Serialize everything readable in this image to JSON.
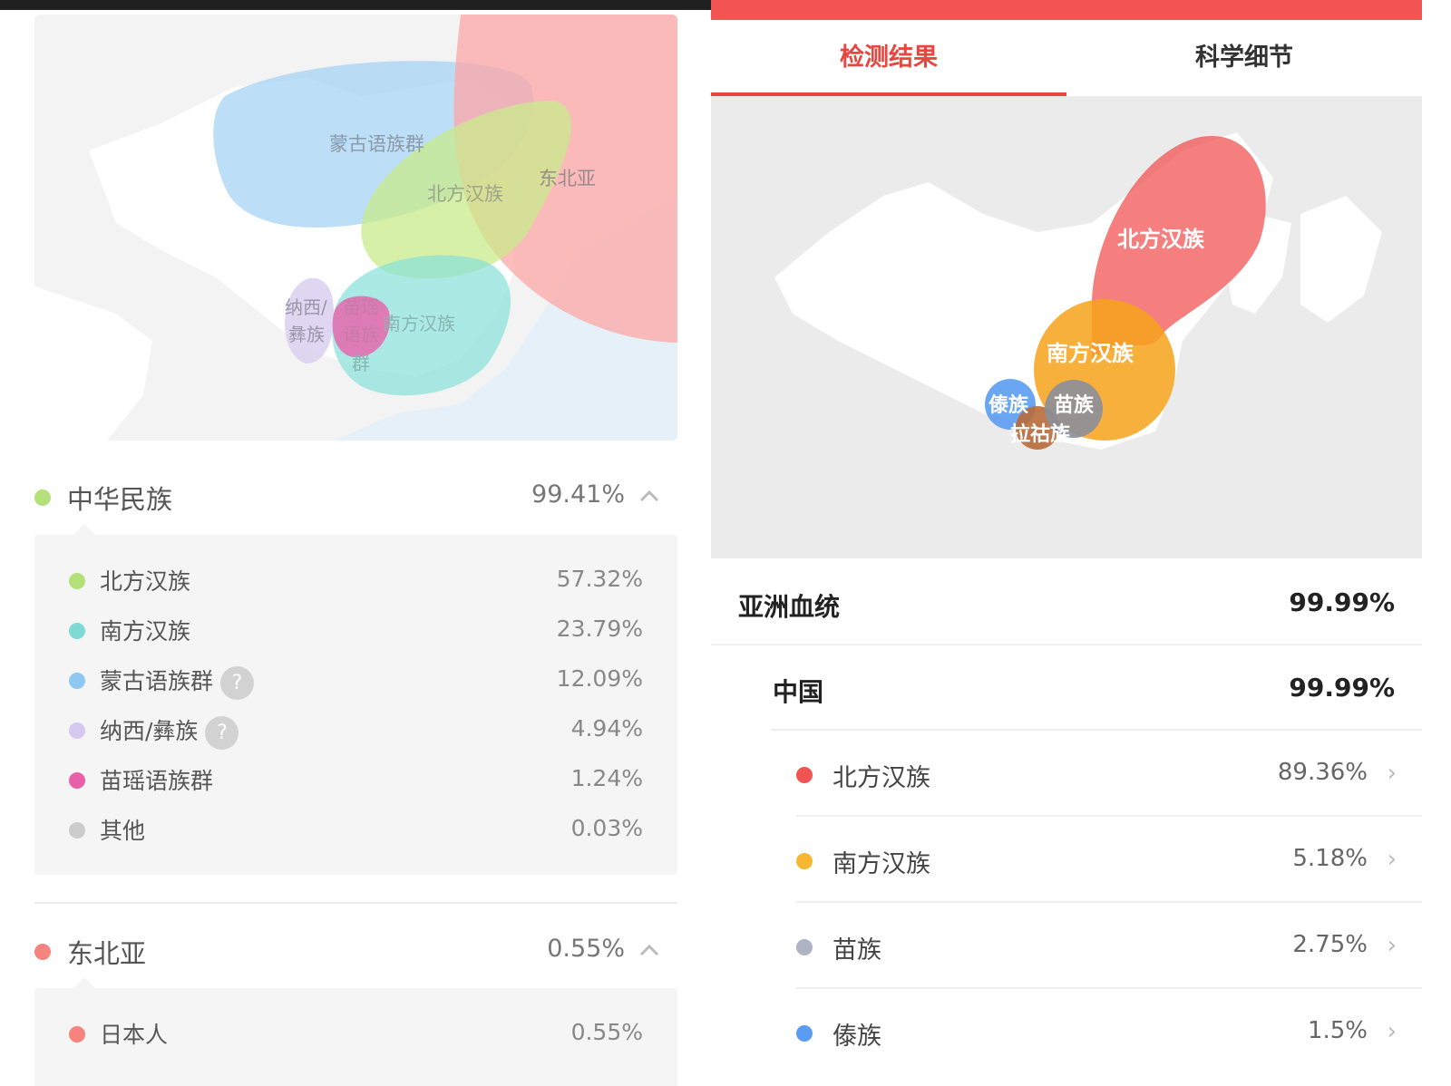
{
  "left": {
    "map_labels": {
      "mongolic": "蒙古语族群",
      "northeast_asia": "东北亚",
      "northern_han": "北方汉族",
      "naxi_line1": "纳西/",
      "naxi_line2": "彝族",
      "miaoyao_line1": "苗瑶",
      "miaoyao_line2": "语族",
      "miaoyao_line3": "群",
      "southern_han": "南方汉族"
    },
    "groups": [
      {
        "name": "中华民族",
        "percent": "99.41%",
        "color": "#b4e07a",
        "items": [
          {
            "name": "北方汉族",
            "percent": "57.32%",
            "color": "#b4e07a"
          },
          {
            "name": "南方汉族",
            "percent": "23.79%",
            "color": "#7fd9d4"
          },
          {
            "name": "蒙古语族群",
            "percent": "12.09%",
            "color": "#8ec8f2",
            "help": "?"
          },
          {
            "name": "纳西/彝族",
            "percent": "4.94%",
            "color": "#d6c8ee",
            "help": "?"
          },
          {
            "name": "苗瑶语族群",
            "percent": "1.24%",
            "color": "#e95fa9"
          },
          {
            "name": "其他",
            "percent": "0.03%",
            "color": "#cccccc"
          }
        ]
      },
      {
        "name": "东北亚",
        "percent": "0.55%",
        "color": "#f7837f",
        "items": [
          {
            "name": "日本人",
            "percent": "0.55%",
            "color": "#f7837f"
          }
        ]
      }
    ]
  },
  "right": {
    "tabs": [
      {
        "label": "检测结果",
        "active": true
      },
      {
        "label": "科学细节",
        "active": false
      }
    ],
    "map_labels": {
      "northern_han": "北方汉族",
      "southern_han": "南方汉族",
      "dai": "傣族",
      "miao": "苗族",
      "lahu": "拉祜族"
    },
    "summary": [
      {
        "name": "亚洲血统",
        "percent": "99.99%"
      },
      {
        "name": "中国",
        "percent": "99.99%"
      }
    ],
    "items": [
      {
        "name": "北方汉族",
        "percent": "89.36%",
        "color": "#f25454",
        "arrow": "›"
      },
      {
        "name": "南方汉族",
        "percent": "5.18%",
        "color": "#f7b733",
        "arrow": "›"
      },
      {
        "name": "苗族",
        "percent": "2.75%",
        "color": "#aeb4c4",
        "arrow": "›"
      },
      {
        "name": "傣族",
        "percent": "1.5%",
        "color": "#5b9cf2",
        "arrow": "›"
      }
    ],
    "accent": "#e9463f"
  }
}
